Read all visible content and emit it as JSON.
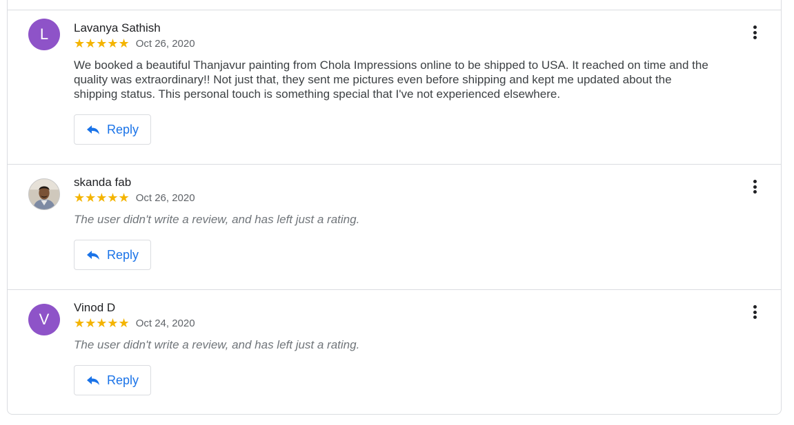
{
  "colors": {
    "star": "#f4b400",
    "reply_text": "#1a73e8",
    "avatar_purple": "#8e53c8",
    "border": "#dadce0"
  },
  "reviews": [
    {
      "initial": "L",
      "name": "Lavanya Sathish",
      "rating": 5,
      "stars": "★★★★★",
      "date": "Oct 26, 2020",
      "text": "We booked a beautiful Thanjavur painting from Chola Impressions online to be shipped to USA. It reached on time and the quality was extraordinary!! Not just that, they sent me pictures even before shipping and kept me updated about the shipping status. This personal touch is something special that I've not experienced elsewhere.",
      "reply_label": "Reply",
      "avatar_icon": "letter-avatar"
    },
    {
      "initial": "",
      "name": "skanda fab",
      "rating": 5,
      "stars": "★★★★★",
      "date": "Oct 26, 2020",
      "text": "The user didn't write a review, and has left just a rating.",
      "reply_label": "Reply",
      "avatar_icon": "profile-photo"
    },
    {
      "initial": "V",
      "name": "Vinod D",
      "rating": 5,
      "stars": "★★★★★",
      "date": "Oct 24, 2020",
      "text": "The user didn't write a review, and has left just a rating.",
      "reply_label": "Reply",
      "avatar_icon": "letter-avatar"
    }
  ]
}
